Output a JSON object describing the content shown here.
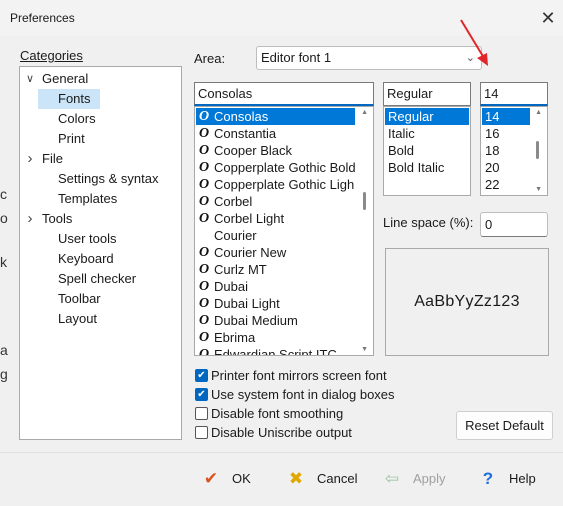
{
  "window": {
    "title": "Preferences",
    "close_glyph": "✕"
  },
  "background_fragments": [
    "c",
    "o",
    "k",
    "a",
    "g"
  ],
  "categories": {
    "label": "Categories",
    "tree": [
      {
        "label": "General",
        "level": 0,
        "expanded": true
      },
      {
        "label": "Fonts",
        "level": 1,
        "selected": true
      },
      {
        "label": "Colors",
        "level": 1
      },
      {
        "label": "Print",
        "level": 1
      },
      {
        "label": "File",
        "level": 0,
        "expanded": false
      },
      {
        "label": "Settings & syntax",
        "level": 1
      },
      {
        "label": "Templates",
        "level": 1
      },
      {
        "label": "Tools",
        "level": 0,
        "expanded": false
      },
      {
        "label": "User tools",
        "level": 1
      },
      {
        "label": "Keyboard",
        "level": 1
      },
      {
        "label": "Spell checker",
        "level": 1
      },
      {
        "label": "Toolbar",
        "level": 1
      },
      {
        "label": "Layout",
        "level": 1
      }
    ]
  },
  "area": {
    "label": "Area:",
    "value": "Editor font 1"
  },
  "font": {
    "name_value": "Consolas",
    "list": [
      "Consolas",
      "Constantia",
      "Cooper Black",
      "Copperplate Gothic Bold",
      "Copperplate Gothic Ligh",
      "Corbel",
      "Corbel Light",
      "Courier",
      "Courier New",
      "Curlz MT",
      "Dubai",
      "Dubai Light",
      "Dubai Medium",
      "Ebrima",
      "Edwardian Script ITC"
    ],
    "selected_index": 0
  },
  "style": {
    "value": "Regular",
    "list": [
      "Regular",
      "Italic",
      "Bold",
      "Bold Italic"
    ],
    "selected_index": 0
  },
  "size": {
    "value": "14",
    "list": [
      "14",
      "16",
      "18",
      "20",
      "22"
    ],
    "selected_index": 0
  },
  "line_space": {
    "label": "Line space (%):",
    "value": "0"
  },
  "preview_text": "AaBbYyZz123",
  "options": [
    {
      "label": "Printer font mirrors screen font",
      "checked": true
    },
    {
      "label": "Use system font in dialog boxes",
      "checked": true
    },
    {
      "label": "Disable font smoothing",
      "checked": false
    },
    {
      "label": "Disable Uniscribe output",
      "checked": false
    }
  ],
  "reset_button": "Reset Default",
  "buttons": {
    "ok": "OK",
    "cancel": "Cancel",
    "apply": "Apply",
    "help": "Help"
  },
  "colors": {
    "accent": "#0078d7",
    "selection_light": "#cce4f7",
    "arrow": "#e0262b"
  }
}
